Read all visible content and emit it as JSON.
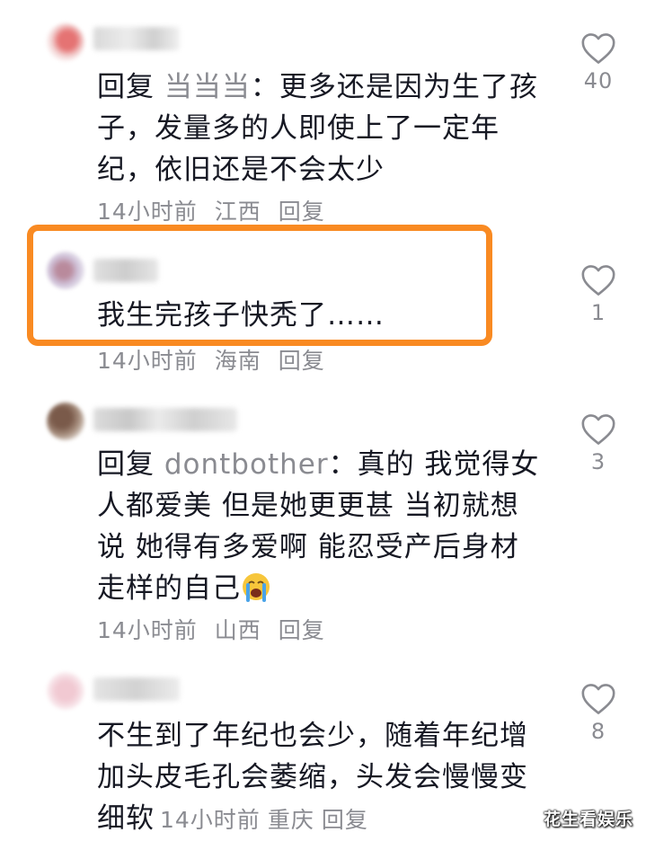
{
  "comments": [
    {
      "reply_prefix": "回复",
      "mention": "当当当",
      "separator": "：",
      "text": "更多还是因为生了孩子，发量多的人即使上了一定年纪，依旧还是不会太少",
      "time": "14小时前",
      "location": "江西",
      "reply_label": "回复",
      "likes": "40"
    },
    {
      "text": "我生完孩子快秃了……",
      "time": "14小时前",
      "location": "海南",
      "reply_label": "回复",
      "likes": "1"
    },
    {
      "reply_prefix": "回复",
      "mention": "dontbother",
      "separator": "：",
      "text": "真的 我觉得女人都爱美 但是她更更甚 当初就想说 她得有多爱啊 能忍受产后身材走样的自己",
      "time": "14小时前",
      "location": "山西",
      "reply_label": "回复",
      "likes": "3"
    },
    {
      "text": "不生到了年纪也会少，随着年纪增加头皮毛孔会萎缩，头发会慢慢变细软",
      "time": "14小时前",
      "location": "重庆",
      "reply_label": "回复",
      "likes": "8"
    }
  ],
  "icons": {
    "like": "heart-outline-icon",
    "emoji": "crying-face-emoji"
  },
  "colors": {
    "highlight": "#f98a22",
    "meta_text": "#8a8b91",
    "body_text": "#161823"
  },
  "watermark": "花生看娱乐"
}
